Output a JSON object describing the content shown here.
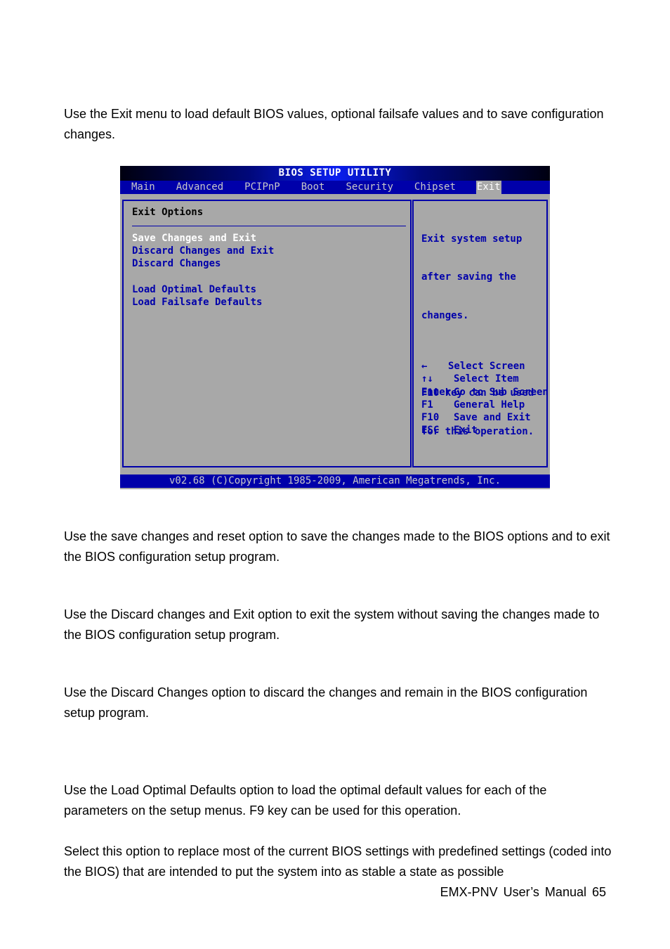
{
  "document": {
    "intro": "Use the Exit menu to load default BIOS values, optional failsafe values and to save configuration changes.",
    "paragraphs": [
      "Use the save changes and reset option to save the changes made to the BIOS options and to exit the BIOS configuration setup program.",
      "Use the Discard changes and Exit option to exit the system without saving the changes made to the BIOS configuration setup program.",
      "Use the Discard Changes option to discard the changes and remain in the BIOS configuration setup program.",
      "Use the Load Optimal Defaults option to load the optimal default values for each of the parameters on the setup menus. F9 key can be used for this operation.",
      "Select this option to replace most of the current BIOS settings with predefined settings (coded into the BIOS) that are intended to put the system into as stable a state as possible"
    ],
    "footer": "EMX-PNV User’s Manual 65"
  },
  "bios": {
    "title": "BIOS SETUP UTILITY",
    "tabs": [
      {
        "label": "Main"
      },
      {
        "label": "Advanced"
      },
      {
        "label": "PCIPnP"
      },
      {
        "label": "Boot"
      },
      {
        "label": "Security"
      },
      {
        "label": "Chipset"
      },
      {
        "label": "Exit",
        "active": true
      }
    ],
    "section_title": "Exit Options",
    "menu_items": [
      {
        "label": "Save Changes and Exit",
        "selected": true
      },
      {
        "label": "Discard Changes and Exit"
      },
      {
        "label": "Discard Changes"
      },
      {
        "label": "Load Optimal Defaults"
      },
      {
        "label": "Load Failsafe Defaults"
      }
    ],
    "help_lines": [
      "Exit system setup",
      "after saving the",
      "changes.",
      "",
      "F10 key can be used",
      "for this operation."
    ],
    "key_legend": [
      {
        "key": "←",
        "desc": "Select Screen"
      },
      {
        "key": "↑↓",
        "desc": "Select Item"
      },
      {
        "key": "Enter",
        "desc": "Go to Sub Screen"
      },
      {
        "key": "F1",
        "desc": "General Help"
      },
      {
        "key": "F10",
        "desc": "Save and Exit"
      },
      {
        "key": "ESC",
        "desc": "Exit"
      }
    ],
    "copyright": "v02.68 (C)Copyright 1985-2009, American Megatrends, Inc.",
    "colors": {
      "background": "#a8a8a8",
      "accent_blue": "#0000aa",
      "highlight_text": "#ffffff"
    }
  }
}
